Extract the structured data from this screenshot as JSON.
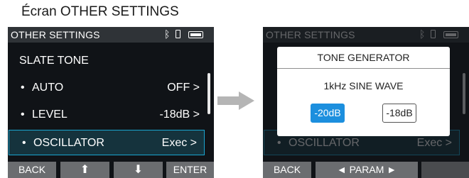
{
  "caption": "Écran OTHER SETTINGS",
  "screen_left": {
    "status": {
      "title": "OTHER SETTINGS",
      "bluetooth_icon": "ᛒ"
    },
    "section_header": "SLATE TONE",
    "bullet": "•",
    "items": [
      {
        "label": "AUTO",
        "value": "OFF >"
      },
      {
        "label": "LEVEL",
        "value": "-18dB >"
      },
      {
        "label": "OSCILLATOR",
        "value": "Exec >",
        "selected": true
      }
    ],
    "softkeys": {
      "back": "BACK",
      "up": "⬆",
      "down": "⬇",
      "enter": "ENTER"
    }
  },
  "screen_right": {
    "status": {
      "title": "OTHER SETTINGS",
      "bluetooth_icon": "ᛒ"
    },
    "background_row": {
      "label": "OSCILLATOR",
      "value": "Exec >"
    },
    "bullet": "•",
    "dialog": {
      "title": "TONE GENERATOR",
      "wave": "1kHz SINE WAVE",
      "options": [
        {
          "label": "-20dB",
          "selected": true
        },
        {
          "label": "-18dB",
          "selected": false
        }
      ]
    },
    "softkeys": {
      "back": "BACK",
      "param": "◄ PARAM ►"
    }
  },
  "colors": {
    "screen_bg": "#101317",
    "statusbar_bg": "#2f3337",
    "highlight_border": "#1aa5cf",
    "softkey_bg": "#6b6d70",
    "selected_option": "#1c8fde",
    "arrow": "#b5b5b5"
  }
}
